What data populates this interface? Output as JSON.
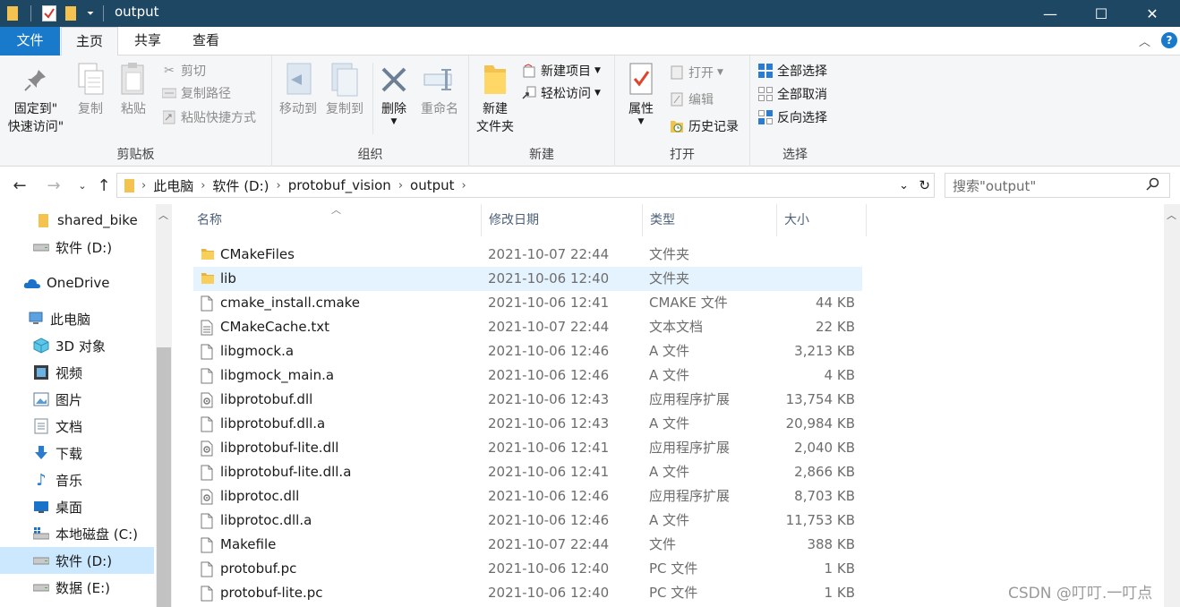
{
  "window": {
    "title": "output",
    "minimize": "—",
    "maximize": "☐",
    "close": "✕"
  },
  "tabs": {
    "file": "文件",
    "home": "主页",
    "share": "共享",
    "view": "查看"
  },
  "ribbon": {
    "clipboard": {
      "pin_line1": "固定到\"",
      "pin_line2": "快速访问\"",
      "copy": "复制",
      "paste": "粘贴",
      "cut": "剪切",
      "copy_path": "复制路径",
      "paste_shortcut": "粘贴快捷方式",
      "label": "剪贴板"
    },
    "organize": {
      "move_to": "移动到",
      "copy_to": "复制到",
      "delete": "删除",
      "rename": "重命名",
      "label": "组织"
    },
    "new": {
      "new_folder_line1": "新建",
      "new_folder_line2": "文件夹",
      "new_item": "新建项目",
      "easy_access": "轻松访问",
      "label": "新建"
    },
    "open": {
      "properties": "属性",
      "open": "打开",
      "edit": "编辑",
      "history": "历史记录",
      "label": "打开"
    },
    "select": {
      "select_all": "全部选择",
      "select_none": "全部取消",
      "invert": "反向选择",
      "label": "选择"
    }
  },
  "address": {
    "crumbs": [
      "此电脑",
      "软件 (D:)",
      "protobuf_vision",
      "output"
    ],
    "search_placeholder": "搜索\"output\""
  },
  "nav": [
    {
      "label": "shared_bike",
      "icon": "folder-icon"
    },
    {
      "label": "软件 (D:)",
      "icon": "drive-icon"
    },
    {
      "label": "OneDrive",
      "icon": "cloud-icon"
    },
    {
      "label": "此电脑",
      "icon": "computer-icon"
    },
    {
      "label": "3D 对象",
      "icon": "3d-objects-icon"
    },
    {
      "label": "视频",
      "icon": "video-icon"
    },
    {
      "label": "图片",
      "icon": "pictures-icon"
    },
    {
      "label": "文档",
      "icon": "documents-icon"
    },
    {
      "label": "下载",
      "icon": "download-icon"
    },
    {
      "label": "音乐",
      "icon": "music-icon"
    },
    {
      "label": "桌面",
      "icon": "desktop-icon"
    },
    {
      "label": "本地磁盘 (C:)",
      "icon": "system-drive-icon"
    },
    {
      "label": "软件 (D:)",
      "icon": "drive-icon"
    },
    {
      "label": "数据 (E:)",
      "icon": "drive-icon"
    }
  ],
  "columns": {
    "name": "名称",
    "date": "修改日期",
    "type": "类型",
    "size": "大小"
  },
  "files": [
    {
      "name": "CMakeFiles",
      "date": "2021-10-07 22:44",
      "type": "文件夹",
      "size": "",
      "icon": "folder-icon"
    },
    {
      "name": "lib",
      "date": "2021-10-06 12:40",
      "type": "文件夹",
      "size": "",
      "icon": "folder-icon"
    },
    {
      "name": "cmake_install.cmake",
      "date": "2021-10-06 12:41",
      "type": "CMAKE 文件",
      "size": "44 KB",
      "icon": "file-icon"
    },
    {
      "name": "CMakeCache.txt",
      "date": "2021-10-07 22:44",
      "type": "文本文档",
      "size": "22 KB",
      "icon": "text-file-icon"
    },
    {
      "name": "libgmock.a",
      "date": "2021-10-06 12:46",
      "type": "A 文件",
      "size": "3,213 KB",
      "icon": "file-icon"
    },
    {
      "name": "libgmock_main.a",
      "date": "2021-10-06 12:46",
      "type": "A 文件",
      "size": "4 KB",
      "icon": "file-icon"
    },
    {
      "name": "libprotobuf.dll",
      "date": "2021-10-06 12:43",
      "type": "应用程序扩展",
      "size": "13,754 KB",
      "icon": "dll-icon"
    },
    {
      "name": "libprotobuf.dll.a",
      "date": "2021-10-06 12:43",
      "type": "A 文件",
      "size": "20,984 KB",
      "icon": "file-icon"
    },
    {
      "name": "libprotobuf-lite.dll",
      "date": "2021-10-06 12:41",
      "type": "应用程序扩展",
      "size": "2,040 KB",
      "icon": "dll-icon"
    },
    {
      "name": "libprotobuf-lite.dll.a",
      "date": "2021-10-06 12:41",
      "type": "A 文件",
      "size": "2,866 KB",
      "icon": "file-icon"
    },
    {
      "name": "libprotoc.dll",
      "date": "2021-10-06 12:46",
      "type": "应用程序扩展",
      "size": "8,703 KB",
      "icon": "dll-icon"
    },
    {
      "name": "libprotoc.dll.a",
      "date": "2021-10-06 12:46",
      "type": "A 文件",
      "size": "11,753 KB",
      "icon": "file-icon"
    },
    {
      "name": "Makefile",
      "date": "2021-10-07 22:44",
      "type": "文件",
      "size": "388 KB",
      "icon": "file-icon"
    },
    {
      "name": "protobuf.pc",
      "date": "2021-10-06 12:40",
      "type": "PC 文件",
      "size": "1 KB",
      "icon": "file-icon"
    },
    {
      "name": "protobuf-lite.pc",
      "date": "2021-10-06 12:40",
      "type": "PC 文件",
      "size": "1 KB",
      "icon": "file-icon"
    }
  ],
  "selected_file": "lib",
  "watermark": "CSDN @叮叮.一叮点",
  "colors": {
    "titlebar": "#1e4763",
    "file_tab": "#1979ca",
    "selection": "#cce8ff",
    "hover_row": "#e5f3ff",
    "folder": "#f4c24f"
  }
}
